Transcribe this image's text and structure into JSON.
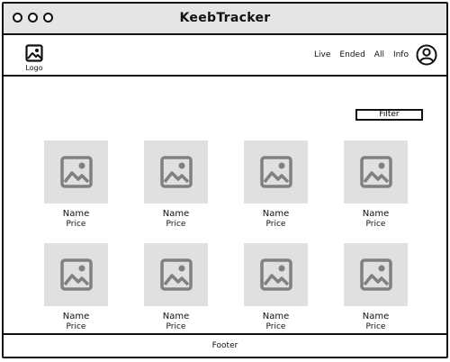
{
  "window": {
    "title": "KeebTracker"
  },
  "header": {
    "logo_label": "Logo",
    "logo_icon": "image-icon",
    "nav": [
      "Live",
      "Ended",
      "All",
      "Info"
    ],
    "account_icon": "user-icon"
  },
  "filter": {
    "label": "Filter"
  },
  "products": [
    {
      "name": "Name",
      "price": "Price",
      "icon": "image-placeholder-icon"
    },
    {
      "name": "Name",
      "price": "Price",
      "icon": "image-placeholder-icon"
    },
    {
      "name": "Name",
      "price": "Price",
      "icon": "image-placeholder-icon"
    },
    {
      "name": "Name",
      "price": "Price",
      "icon": "image-placeholder-icon"
    },
    {
      "name": "Name",
      "price": "Price",
      "icon": "image-placeholder-icon"
    },
    {
      "name": "Name",
      "price": "Price",
      "icon": "image-placeholder-icon"
    },
    {
      "name": "Name",
      "price": "Price",
      "icon": "image-placeholder-icon"
    },
    {
      "name": "Name",
      "price": "Price",
      "icon": "image-placeholder-icon"
    }
  ],
  "footer": {
    "label": "Footer"
  },
  "colors": {
    "placeholder_bg": "#e0e0e0",
    "placeholder_icon": "#808080",
    "titlebar_bg": "#e5e5e5"
  }
}
